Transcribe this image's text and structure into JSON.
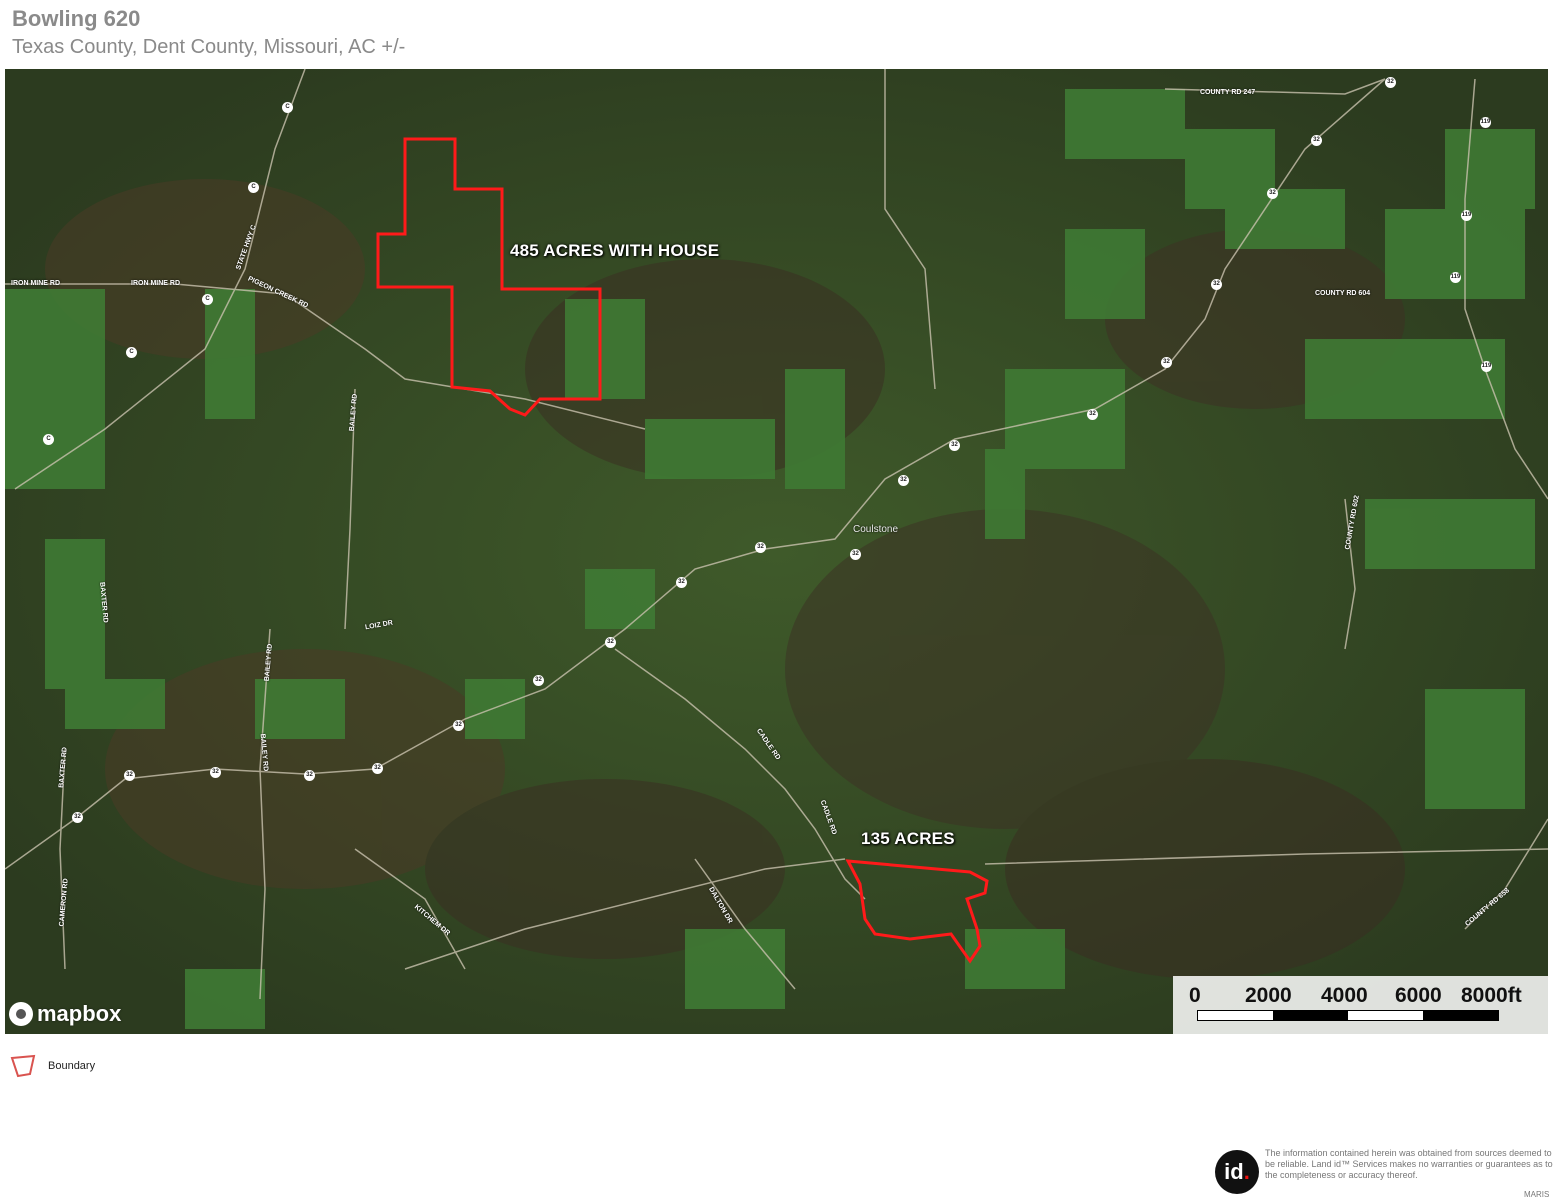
{
  "header": {
    "title": "Bowling 620",
    "subtitle": "Texas County, Dent County, Missouri,  AC +/-"
  },
  "map": {
    "parcels": [
      {
        "label": "485 ACRES WITH HOUSE",
        "color": "#ff1a1a"
      },
      {
        "label": "135 ACRES",
        "color": "#ff1a1a"
      }
    ],
    "town": "Coulstone",
    "road_labels": {
      "iron_mine_rd_1": "IRON MINE RD",
      "iron_mine_rd_2": "IRON MINE RD",
      "pigeon_creek_rd": "PIGEON CREEK RD",
      "state_hwy_c": "STATE HWY C",
      "bailey_rd_1": "BAILEY RD",
      "bailey_rd_2": "BAILEY RD",
      "bailey_rd_3": "BAILEY RD",
      "baxter_rd_1": "BAXTER RD",
      "baxter_rd_2": "BAXTER RD",
      "cameron_rd": "CAMERON RD",
      "loiz_dr": "LOIZ DR",
      "cadle_rd_1": "CADLE RD",
      "cadle_rd_2": "CADLE RD",
      "dalton_dr": "DALTON DR",
      "kitchem_dr": "KITCHEM DR",
      "county_rd_247": "COUNTY RD 247",
      "county_rd_604": "COUNTY RD 604",
      "county_rd_602": "COUNTY RD 602",
      "county_rd_658": "COUNTY RD 658"
    },
    "shields": {
      "s32": "32",
      "s119": "119",
      "sc": "C"
    },
    "attribution": "mapbox",
    "scale": {
      "labels": [
        "0",
        "2000",
        "4000",
        "6000",
        "8000ft"
      ]
    }
  },
  "legend": {
    "boundary_label": "Boundary",
    "boundary_color": "#d9534f"
  },
  "footer": {
    "logo_text": "id",
    "logo_dot": ".",
    "disclaimer": "The information contained herein was obtained from sources deemed to be reliable. Land id™ Services makes no warranties or guarantees as to the completeness or accuracy thereof.",
    "maris": "MARIS"
  }
}
